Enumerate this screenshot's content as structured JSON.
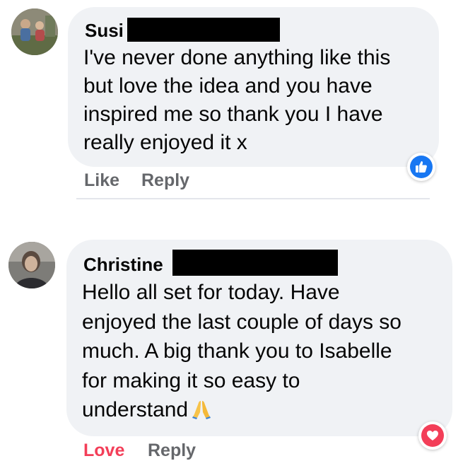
{
  "comments": [
    {
      "author": "Susi",
      "lines": [
        "I've never done anything like this",
        "but love the idea and you have",
        "inspired me so thank you I have",
        "really enjoyed it x"
      ],
      "actions": {
        "primary": "Like",
        "reply": "Reply"
      },
      "reaction_icon": "thumbs-up-icon",
      "reaction_color": "#1877f2"
    },
    {
      "author": "Christine",
      "lines": [
        "Hello all set for today. Have",
        "enjoyed the last couple of days so",
        "much. A big thank you to Isabelle",
        "for making it so easy to",
        "understand"
      ],
      "emoji": "folded-hands-icon",
      "actions": {
        "primary": "Love",
        "reply": "Reply"
      },
      "reaction_icon": "heart-icon",
      "reaction_color": "#f33e58"
    }
  ]
}
